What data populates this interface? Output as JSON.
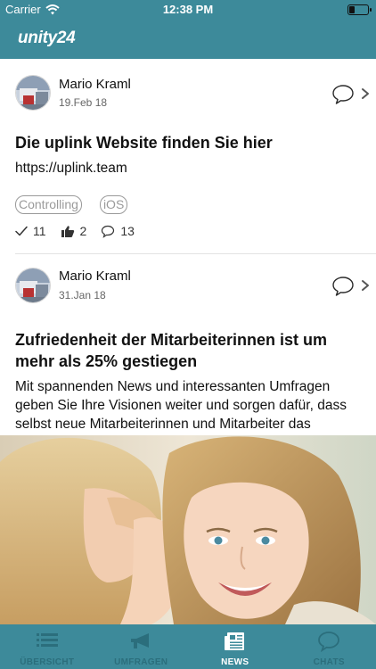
{
  "status_bar": {
    "carrier": "Carrier",
    "time": "12:38 PM",
    "battery_level": 0.25
  },
  "header": {
    "app_title": "unity24"
  },
  "posts": [
    {
      "author": "Mario Kraml",
      "date": "19.Feb 18",
      "title": "Die uplink Website finden Sie hier",
      "body": "https://uplink.team",
      "tags": [
        "Controlling",
        "iOS"
      ],
      "stats": {
        "read": "11",
        "likes": "2",
        "comments": "13"
      }
    },
    {
      "author": "Mario Kraml",
      "date": "31.Jan 18",
      "title": "Zufriedenheit der Mitarbeiterinnen ist um mehr als 25% gestiegen",
      "body": "Mit spannenden News und interessanten Umfragen geben Sie Ihre Visionen weiter und sorgen dafür, dass selbst neue Mitarbeiterinnen und Mitarbeiter das Unternehmen und seine Werte schnell kennen lernen....",
      "image_icon": "two-women-whispering-photo"
    }
  ],
  "tab_bar": {
    "tabs": [
      {
        "label": "ÜBERSICHT",
        "icon": "list-icon"
      },
      {
        "label": "UMFRAGEN",
        "icon": "megaphone-icon"
      },
      {
        "label": "NEWS",
        "icon": "newspaper-icon"
      },
      {
        "label": "CHATS",
        "icon": "chat-bubble-icon"
      }
    ],
    "active_tab": "NEWS"
  },
  "colors": {
    "brand": "#3d8a9a",
    "tab_inactive": "#2b6e7c",
    "tag_gray": "#9a9a9a"
  }
}
